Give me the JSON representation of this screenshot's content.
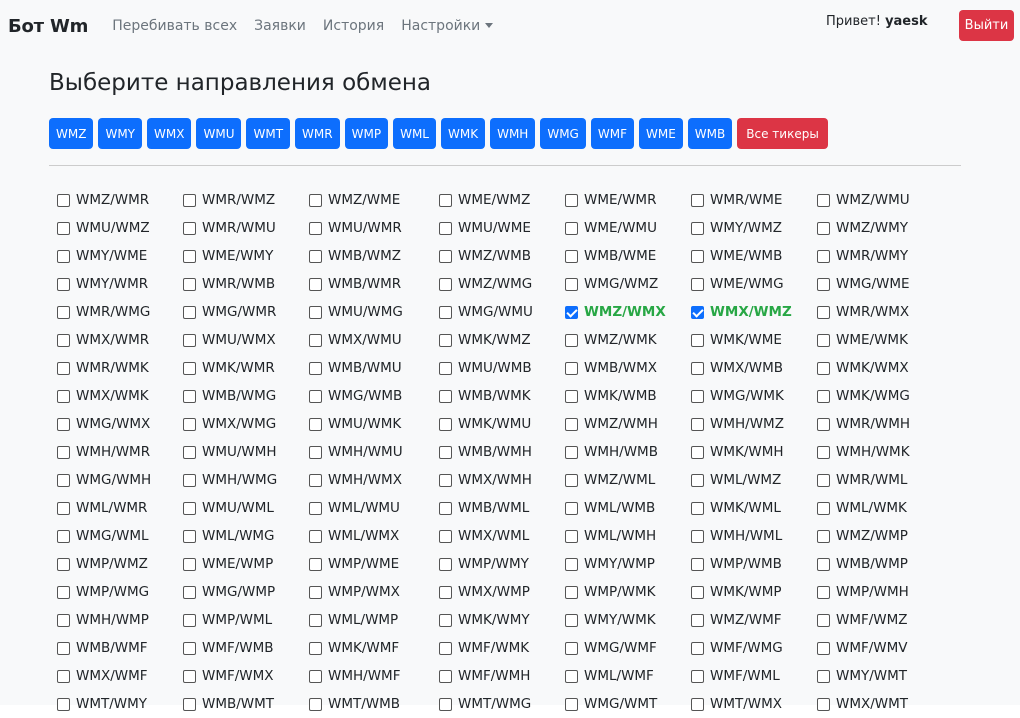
{
  "navbar": {
    "brand": "Бот Wm",
    "links": [
      "Перебивать всех",
      "Заявки",
      "История",
      "Настройки"
    ],
    "greeting": "Привет!",
    "username": "yaesk",
    "logout": "Выйти"
  },
  "page_title": "Выберите направления обмена",
  "tickers": [
    "WMZ",
    "WMY",
    "WMX",
    "WMU",
    "WMT",
    "WMR",
    "WMP",
    "WML",
    "WMK",
    "WMH",
    "WMG",
    "WMF",
    "WME",
    "WMB"
  ],
  "all_tickers": "Все тикеры",
  "checked": [
    "WMZ/WMX",
    "WMX/WMZ"
  ],
  "pairs": [
    [
      "WMZ/WMR",
      "WMR/WMZ",
      "WMZ/WME",
      "WME/WMZ",
      "WME/WMR",
      "WMR/WME",
      "WMZ/WMU"
    ],
    [
      "WMU/WMZ",
      "WMR/WMU",
      "WMU/WMR",
      "WMU/WME",
      "WME/WMU",
      "WMY/WMZ",
      "WMZ/WMY"
    ],
    [
      "WMY/WME",
      "WME/WMY",
      "WMB/WMZ",
      "WMZ/WMB",
      "WMB/WME",
      "WME/WMB",
      "WMR/WMY"
    ],
    [
      "WMY/WMR",
      "WMR/WMB",
      "WMB/WMR",
      "WMZ/WMG",
      "WMG/WMZ",
      "WME/WMG",
      "WMG/WME"
    ],
    [
      "WMR/WMG",
      "WMG/WMR",
      "WMU/WMG",
      "WMG/WMU",
      "WMZ/WMX",
      "WMX/WMZ",
      "WMR/WMX"
    ],
    [
      "WMX/WMR",
      "WMU/WMX",
      "WMX/WMU",
      "WMK/WMZ",
      "WMZ/WMK",
      "WMK/WME",
      "WME/WMK"
    ],
    [
      "WMR/WMK",
      "WMK/WMR",
      "WMB/WMU",
      "WMU/WMB",
      "WMB/WMX",
      "WMX/WMB",
      "WMK/WMX"
    ],
    [
      "WMX/WMK",
      "WMB/WMG",
      "WMG/WMB",
      "WMB/WMK",
      "WMK/WMB",
      "WMG/WMK",
      "WMK/WMG"
    ],
    [
      "WMG/WMX",
      "WMX/WMG",
      "WMU/WMK",
      "WMK/WMU",
      "WMZ/WMH",
      "WMH/WMZ",
      "WMR/WMH"
    ],
    [
      "WMH/WMR",
      "WMU/WMH",
      "WMH/WMU",
      "WMB/WMH",
      "WMH/WMB",
      "WMK/WMH",
      "WMH/WMK"
    ],
    [
      "WMG/WMH",
      "WMH/WMG",
      "WMH/WMX",
      "WMX/WMH",
      "WMZ/WML",
      "WML/WMZ",
      "WMR/WML"
    ],
    [
      "WML/WMR",
      "WMU/WML",
      "WML/WMU",
      "WMB/WML",
      "WML/WMB",
      "WMK/WML",
      "WML/WMK"
    ],
    [
      "WMG/WML",
      "WML/WMG",
      "WML/WMX",
      "WMX/WML",
      "WML/WMH",
      "WMH/WML",
      "WMZ/WMP"
    ],
    [
      "WMP/WMZ",
      "WME/WMP",
      "WMP/WME",
      "WMP/WMY",
      "WMY/WMP",
      "WMP/WMB",
      "WMB/WMP"
    ],
    [
      "WMP/WMG",
      "WMG/WMP",
      "WMP/WMX",
      "WMX/WMP",
      "WMP/WMK",
      "WMK/WMP",
      "WMP/WMH"
    ],
    [
      "WMH/WMP",
      "WMP/WML",
      "WML/WMP",
      "WMK/WMY",
      "WMY/WMK",
      "WMZ/WMF",
      "WMF/WMZ"
    ],
    [
      "WMB/WMF",
      "WMF/WMB",
      "WMK/WMF",
      "WMF/WMK",
      "WMG/WMF",
      "WMF/WMG",
      "WMF/WMV"
    ],
    [
      "WMX/WMF",
      "WMF/WMX",
      "WMH/WMF",
      "WMF/WMH",
      "WML/WMF",
      "WMF/WML",
      "WMY/WMT"
    ],
    [
      "WMT/WMY",
      "WMB/WMT",
      "WMT/WMB",
      "WMT/WMG",
      "WMG/WMT",
      "WMT/WMX",
      "WMX/WMT"
    ]
  ]
}
